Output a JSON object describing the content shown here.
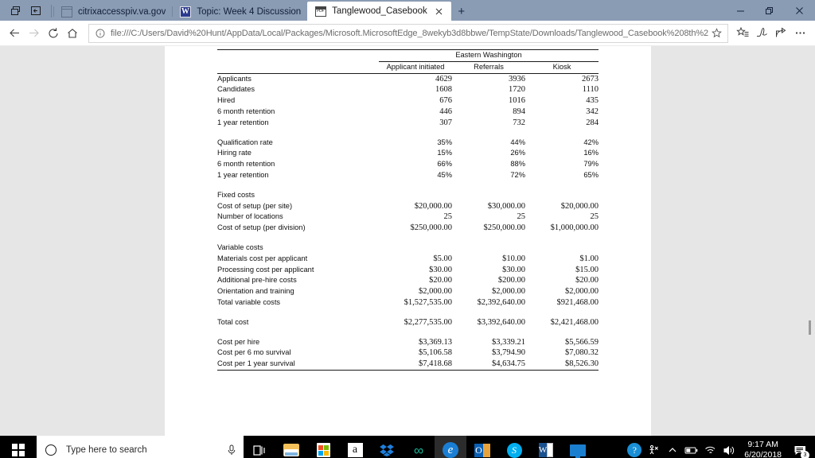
{
  "window": {
    "tabs": [
      {
        "title": "citrixaccesspiv.va.gov",
        "favicon": "window-icon",
        "active": false
      },
      {
        "title": "Topic: Week 4 Discussion",
        "favicon": "wikipedia-w-icon",
        "active": false
      },
      {
        "title": "Tanglewood_Casebook",
        "favicon": "pdf-icon",
        "active": true
      }
    ],
    "new_tab_label": "+",
    "tab_close_label": "✕",
    "sys_buttons": {
      "tab_preview": "tab-preview-icon",
      "set_aside": "set-tabs-aside-icon"
    },
    "controls": {
      "minimize": "—",
      "restore": "❐",
      "close": "✕"
    }
  },
  "navbar": {
    "back": "back-arrow",
    "forward": "forward-arrow",
    "refresh": "refresh-arrow",
    "home": "home-house",
    "address": "file:///C:/Users/David%20Hunt/AppData/Local/Packages/Microsoft.MicrosoftEdge_8wekyb3d8bbwe/TempState/Downloads/Tanglewood_Casebook%208th%2",
    "info_icon": "info-circle-icon",
    "star_icon": "favorite-star-icon",
    "tools": [
      "favorites-hub-icon",
      "web-notes-pen-icon",
      "share-icon",
      "more-ellipsis-icon"
    ]
  },
  "document": {
    "title": "Eastern Washington",
    "columns": [
      "Applicant initiated",
      "Referrals",
      "Kiosk"
    ],
    "rows": [
      {
        "type": "data",
        "label": "Applicants",
        "values": [
          "4629",
          "3936",
          "2673"
        ]
      },
      {
        "type": "data",
        "label": "Candidates",
        "values": [
          "1608",
          "1720",
          "1110"
        ]
      },
      {
        "type": "data",
        "label": "Hired",
        "values": [
          "676",
          "1016",
          "435"
        ]
      },
      {
        "type": "data",
        "label": "6 month retention",
        "values": [
          "446",
          "894",
          "342"
        ]
      },
      {
        "type": "data",
        "label": "1 year retention",
        "values": [
          "307",
          "732",
          "284"
        ]
      },
      {
        "type": "spacer",
        "label": "",
        "values": [
          "",
          "",
          ""
        ]
      },
      {
        "type": "pct",
        "label": "Qualification rate",
        "values": [
          "35%",
          "44%",
          "42%"
        ]
      },
      {
        "type": "pct",
        "label": "Hiring rate",
        "values": [
          "15%",
          "26%",
          "16%"
        ]
      },
      {
        "type": "pct",
        "label": "6 month retention",
        "values": [
          "66%",
          "88%",
          "79%"
        ]
      },
      {
        "type": "pct",
        "label": "1 year retention",
        "values": [
          "45%",
          "72%",
          "65%"
        ]
      },
      {
        "type": "spacer",
        "label": "",
        "values": [
          "",
          "",
          ""
        ]
      },
      {
        "type": "head",
        "label": "Fixed costs",
        "values": [
          "",
          "",
          ""
        ]
      },
      {
        "type": "data",
        "label": "Cost of setup (per site)",
        "values": [
          "$20,000.00",
          "$30,000.00",
          "$20,000.00"
        ]
      },
      {
        "type": "data",
        "label": "Number of locations",
        "values": [
          "25",
          "25",
          "25"
        ]
      },
      {
        "type": "data",
        "label": "Cost of setup (per division)",
        "values": [
          "$250,000.00",
          "$250,000.00",
          "$1,000,000.00"
        ]
      },
      {
        "type": "spacer",
        "label": "",
        "values": [
          "",
          "",
          ""
        ]
      },
      {
        "type": "head",
        "label": "Variable costs",
        "values": [
          "",
          "",
          ""
        ]
      },
      {
        "type": "data",
        "label": "Materials cost per applicant",
        "values": [
          "$5.00",
          "$10.00",
          "$1.00"
        ]
      },
      {
        "type": "data",
        "label": "Processing cost per applicant",
        "values": [
          "$30.00",
          "$30.00",
          "$15.00"
        ]
      },
      {
        "type": "data",
        "label": "Additional pre-hire costs",
        "values": [
          "$20.00",
          "$200.00",
          "$20.00"
        ]
      },
      {
        "type": "data",
        "label": "Orientation and training",
        "values": [
          "$2,000.00",
          "$2,000.00",
          "$2,000.00"
        ]
      },
      {
        "type": "data",
        "label": "Total variable costs",
        "values": [
          "$1,527,535.00",
          "$2,392,640.00",
          "$921,468.00"
        ]
      },
      {
        "type": "spacer",
        "label": "",
        "values": [
          "",
          "",
          ""
        ]
      },
      {
        "type": "data",
        "label": "Total cost",
        "values": [
          "$2,277,535.00",
          "$3,392,640.00",
          "$2,421,468.00"
        ]
      },
      {
        "type": "spacer",
        "label": "",
        "values": [
          "",
          "",
          ""
        ]
      },
      {
        "type": "data",
        "label": "Cost per hire",
        "values": [
          "$3,369.13",
          "$3,339.21",
          "$5,566.59"
        ]
      },
      {
        "type": "data",
        "label": "Cost per 6 mo survival",
        "values": [
          "$5,106.58",
          "$3,794.90",
          "$7,080.32"
        ]
      },
      {
        "type": "last",
        "label": "Cost per 1 year survival",
        "values": [
          "$7,418.68",
          "$4,634.75",
          "$8,526.30"
        ]
      }
    ]
  },
  "taskbar": {
    "start": "windows-start-icon",
    "search_placeholder": "Type here to search",
    "mic_icon": "microphone-icon",
    "task_view": "task-view-icon",
    "apps": [
      {
        "name": "file-explorer",
        "open": true
      },
      {
        "name": "microsoft-store",
        "open": false
      },
      {
        "name": "amazon",
        "open": false
      },
      {
        "name": "dropbox",
        "open": false
      },
      {
        "name": "infinity-app",
        "open": false
      },
      {
        "name": "microsoft-edge",
        "open": true,
        "active": true
      },
      {
        "name": "outlook",
        "open": true
      },
      {
        "name": "skype",
        "open": true
      },
      {
        "name": "microsoft-word",
        "open": true
      },
      {
        "name": "remote-desktop",
        "open": true
      }
    ],
    "tray": [
      "help-icon",
      "accessibility-icon",
      "show-hidden-icons-chevron",
      "battery-icon",
      "wifi-icon",
      "volume-icon"
    ],
    "clock_time": "9:17 AM",
    "clock_date": "6/20/2018",
    "notifications_count": "3"
  },
  "colors": {
    "titlebar": "#8a9bb4",
    "page_bg": "#e6e6e6",
    "taskbar": "#000000",
    "accent": "#3da7e0"
  }
}
